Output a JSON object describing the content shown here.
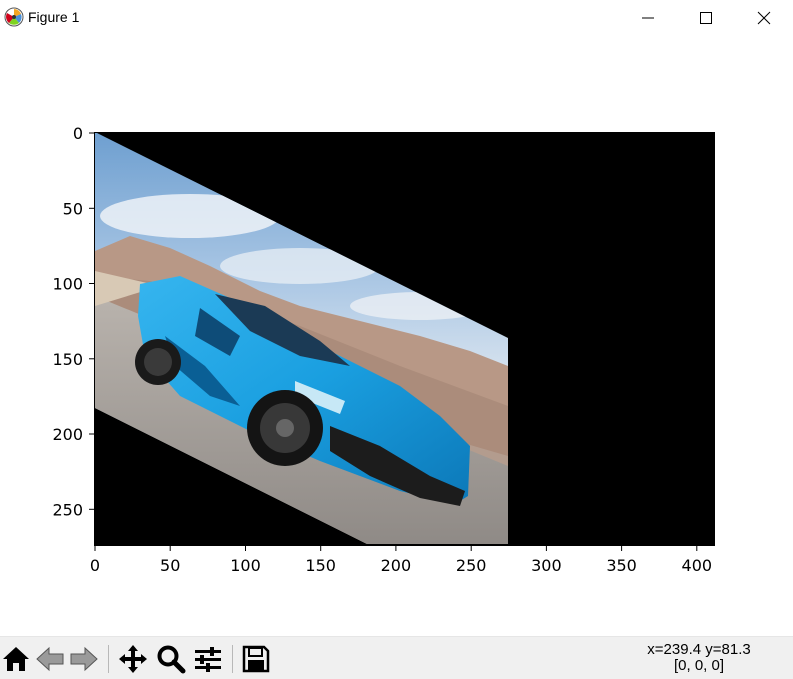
{
  "window": {
    "title": "Figure 1",
    "icon": "matplotlib-logo-icon",
    "controls": [
      "minimize-icon",
      "maximize-icon",
      "close-icon"
    ]
  },
  "plot": {
    "image_description_icon": "blue-sports-car-image",
    "background_color": "#000000",
    "xlim": [
      0,
      412
    ],
    "ylim": [
      275,
      0
    ],
    "x_ticks": [
      "0",
      "50",
      "100",
      "150",
      "200",
      "250",
      "300",
      "350",
      "400"
    ],
    "y_ticks": [
      "0",
      "50",
      "100",
      "150",
      "200",
      "250"
    ]
  },
  "toolbar": {
    "buttons": [
      {
        "name": "home-button",
        "icon": "home-icon"
      },
      {
        "name": "back-button",
        "icon": "arrow-left-icon"
      },
      {
        "name": "forward-button",
        "icon": "arrow-right-icon"
      },
      {
        "name": "pan-button",
        "icon": "move-icon"
      },
      {
        "name": "zoom-button",
        "icon": "magnifier-icon"
      },
      {
        "name": "configure-subplots-button",
        "icon": "sliders-icon"
      },
      {
        "name": "save-button",
        "icon": "floppy-disk-icon"
      }
    ],
    "coords": "x=239.4 y=81.3",
    "pixel_value": "[0, 0, 0]"
  }
}
